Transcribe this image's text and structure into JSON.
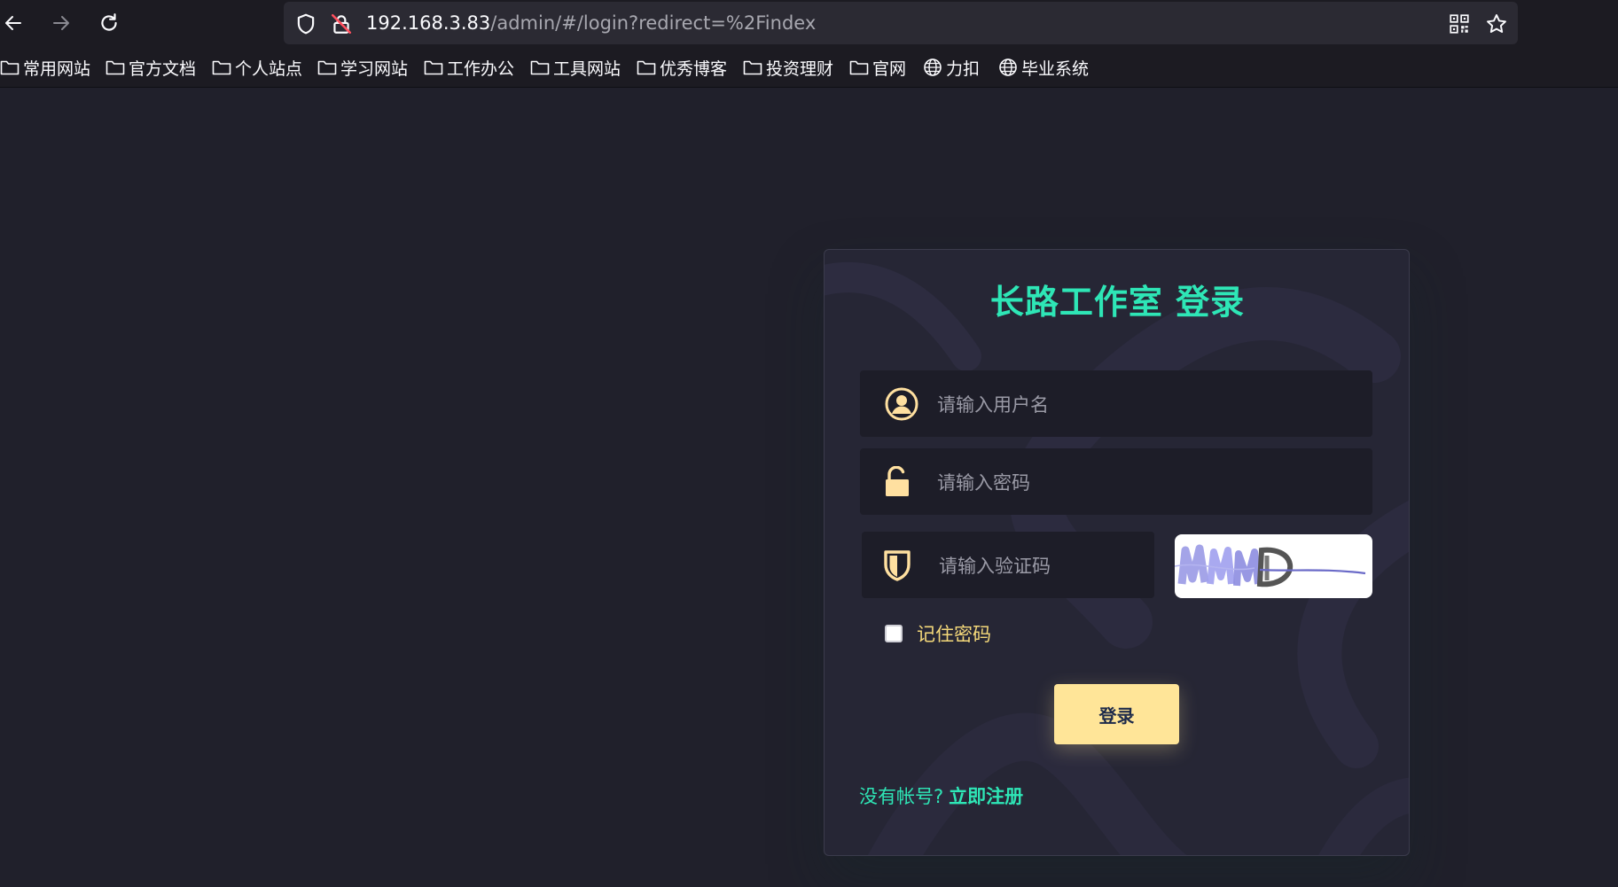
{
  "browser": {
    "url_host": "192.168.3.83",
    "url_path": "/admin/#/login?redirect=%2Findex",
    "bookmarks": [
      {
        "label": "常用网站",
        "icon": "folder-icon"
      },
      {
        "label": "官方文档",
        "icon": "folder-icon"
      },
      {
        "label": "个人站点",
        "icon": "folder-icon"
      },
      {
        "label": "学习网站",
        "icon": "folder-icon"
      },
      {
        "label": "工作办公",
        "icon": "folder-icon"
      },
      {
        "label": "工具网站",
        "icon": "folder-icon"
      },
      {
        "label": "优秀博客",
        "icon": "folder-icon"
      },
      {
        "label": "投资理财",
        "icon": "folder-icon"
      },
      {
        "label": "官网",
        "icon": "folder-icon"
      },
      {
        "label": "力扣",
        "icon": "globe-icon"
      },
      {
        "label": "毕业系统",
        "icon": "globe-icon"
      }
    ]
  },
  "login": {
    "title": "长路工作室 登录",
    "username_placeholder": "请输入用户名",
    "password_placeholder": "请输入密码",
    "captcha_placeholder": "请输入验证码",
    "remember_label": "记住密码",
    "remember_checked": false,
    "submit_label": "登录",
    "register_prompt": "没有帐号?",
    "register_link": "立即注册"
  },
  "colors": {
    "page_bg": "#20202b",
    "card_bg": "#262635",
    "accent": "#2ee6b6",
    "button_bg": "#ffe598",
    "icon_color": "#ffe0a0"
  }
}
